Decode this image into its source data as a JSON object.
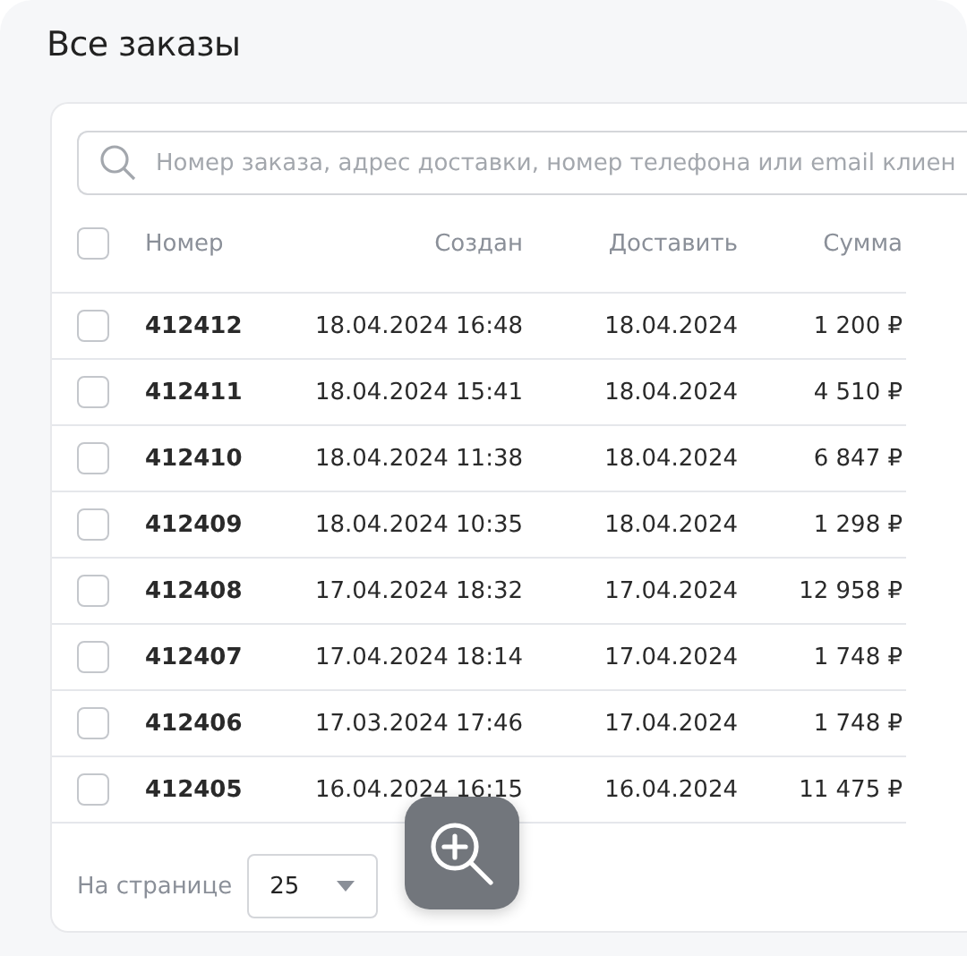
{
  "title": "Все заказы",
  "search": {
    "placeholder": "Номер заказа, адрес доставки, номер телефона или email клиен"
  },
  "table": {
    "select_all": {
      "checked": false
    },
    "columns": [
      "Номер",
      "Создан",
      "Доставить",
      "Сумма"
    ],
    "rows": [
      {
        "checked": false,
        "number": "412412",
        "created": "18.04.2024 16:48",
        "deliver": "18.04.2024",
        "sum": "1 200 ₽"
      },
      {
        "checked": false,
        "number": "412411",
        "created": "18.04.2024 15:41",
        "deliver": "18.04.2024",
        "sum": "4 510 ₽"
      },
      {
        "checked": false,
        "number": "412410",
        "created": "18.04.2024 11:38",
        "deliver": "18.04.2024",
        "sum": "6 847 ₽"
      },
      {
        "checked": false,
        "number": "412409",
        "created": "18.04.2024 10:35",
        "deliver": "18.04.2024",
        "sum": "1 298 ₽"
      },
      {
        "checked": false,
        "number": "412408",
        "created": "17.04.2024 18:32",
        "deliver": "17.04.2024",
        "sum": "12 958 ₽"
      },
      {
        "checked": false,
        "number": "412407",
        "created": "17.04.2024 18:14",
        "deliver": "17.04.2024",
        "sum": "1 748 ₽"
      },
      {
        "checked": false,
        "number": "412406",
        "created": "17.03.2024 17:46",
        "deliver": "17.04.2024",
        "sum": "1 748 ₽"
      },
      {
        "checked": false,
        "number": "412405",
        "created": "16.04.2024 16:15",
        "deliver": "16.04.2024",
        "sum": "11 475 ₽"
      }
    ]
  },
  "pagination": {
    "label": "На странице",
    "per_page": "25"
  }
}
